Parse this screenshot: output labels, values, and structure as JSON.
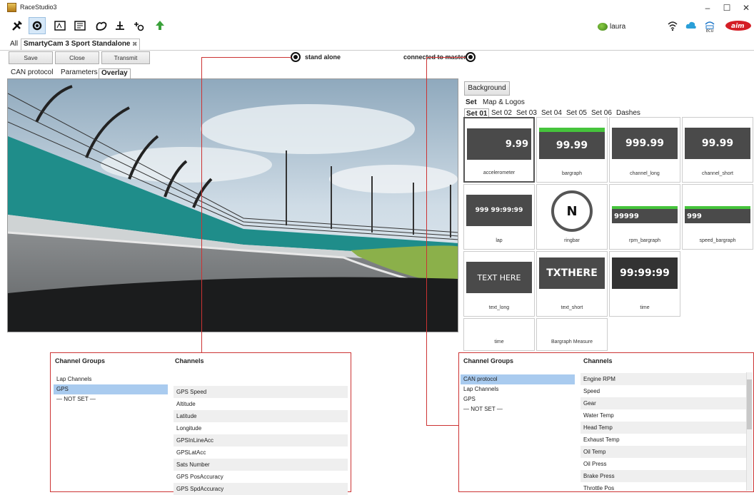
{
  "window": {
    "title": "RaceStudio3",
    "minimize": "–",
    "maximize": "☐",
    "close": "✕"
  },
  "user": {
    "name": "laura"
  },
  "tabs": {
    "all": "All",
    "device": "SmartyCam 3 Sport Standalone",
    "close_glyph": "⌘"
  },
  "actions": {
    "save": "Save",
    "close": "Close",
    "transmit": "Transmit"
  },
  "mode": {
    "standalone": "stand alone",
    "connected": "connected to master"
  },
  "subtabs": [
    "CAN protocol",
    "Parameters",
    "Overlay"
  ],
  "right_panel": {
    "background_btn": "Background",
    "set_tabs": [
      "Set",
      "Map & Logos"
    ],
    "sets": [
      "Set 01",
      "Set 02",
      "Set 03",
      "Set 04",
      "Set 05",
      "Set 06",
      "Dashes"
    ],
    "widgets": [
      {
        "caption": "accelerometer",
        "text": "9.99"
      },
      {
        "caption": "bargraph",
        "text": "99.99"
      },
      {
        "caption": "channel_long",
        "text": "999.99"
      },
      {
        "caption": "channel_short",
        "text": "99.99"
      },
      {
        "caption": "lap",
        "text": "999 99:99:99"
      },
      {
        "caption": "ringbar",
        "text": "N"
      },
      {
        "caption": "rpm_bargraph",
        "text": "99999"
      },
      {
        "caption": "speed_bargraph",
        "text": "999"
      },
      {
        "caption": "text_long",
        "text": "TEXT HERE"
      },
      {
        "caption": "text_short",
        "text": "TXTHERE"
      },
      {
        "caption": "time",
        "text": "99:99:99"
      },
      {
        "caption": "time",
        "text": ""
      },
      {
        "caption": "Bargraph Measure",
        "text": ""
      }
    ]
  },
  "left_channels": {
    "groups_header": "Channel Groups",
    "channels_header": "Channels",
    "groups": [
      "Lap Channels",
      "GPS",
      "— NOT SET —"
    ],
    "channels": [
      "GPS Speed",
      "Altitude",
      "Latitude",
      "Longitude",
      "GPSInLineAcc",
      "GPSLatAcc",
      "Sats Number",
      "GPS PosAccuracy",
      "GPS SpdAccuracy"
    ]
  },
  "right_channels": {
    "groups_header": "Channel Groups",
    "channels_header": "Channels",
    "groups": [
      "CAN protocol",
      "Lap Channels",
      "GPS",
      "— NOT SET —"
    ],
    "channels": [
      "Engine RPM",
      "Speed",
      "Gear",
      "Water Temp",
      "Head Temp",
      "Exhaust Temp",
      "Oil Temp",
      "Oil Press",
      "Brake Press",
      "Throttle Pos"
    ]
  }
}
